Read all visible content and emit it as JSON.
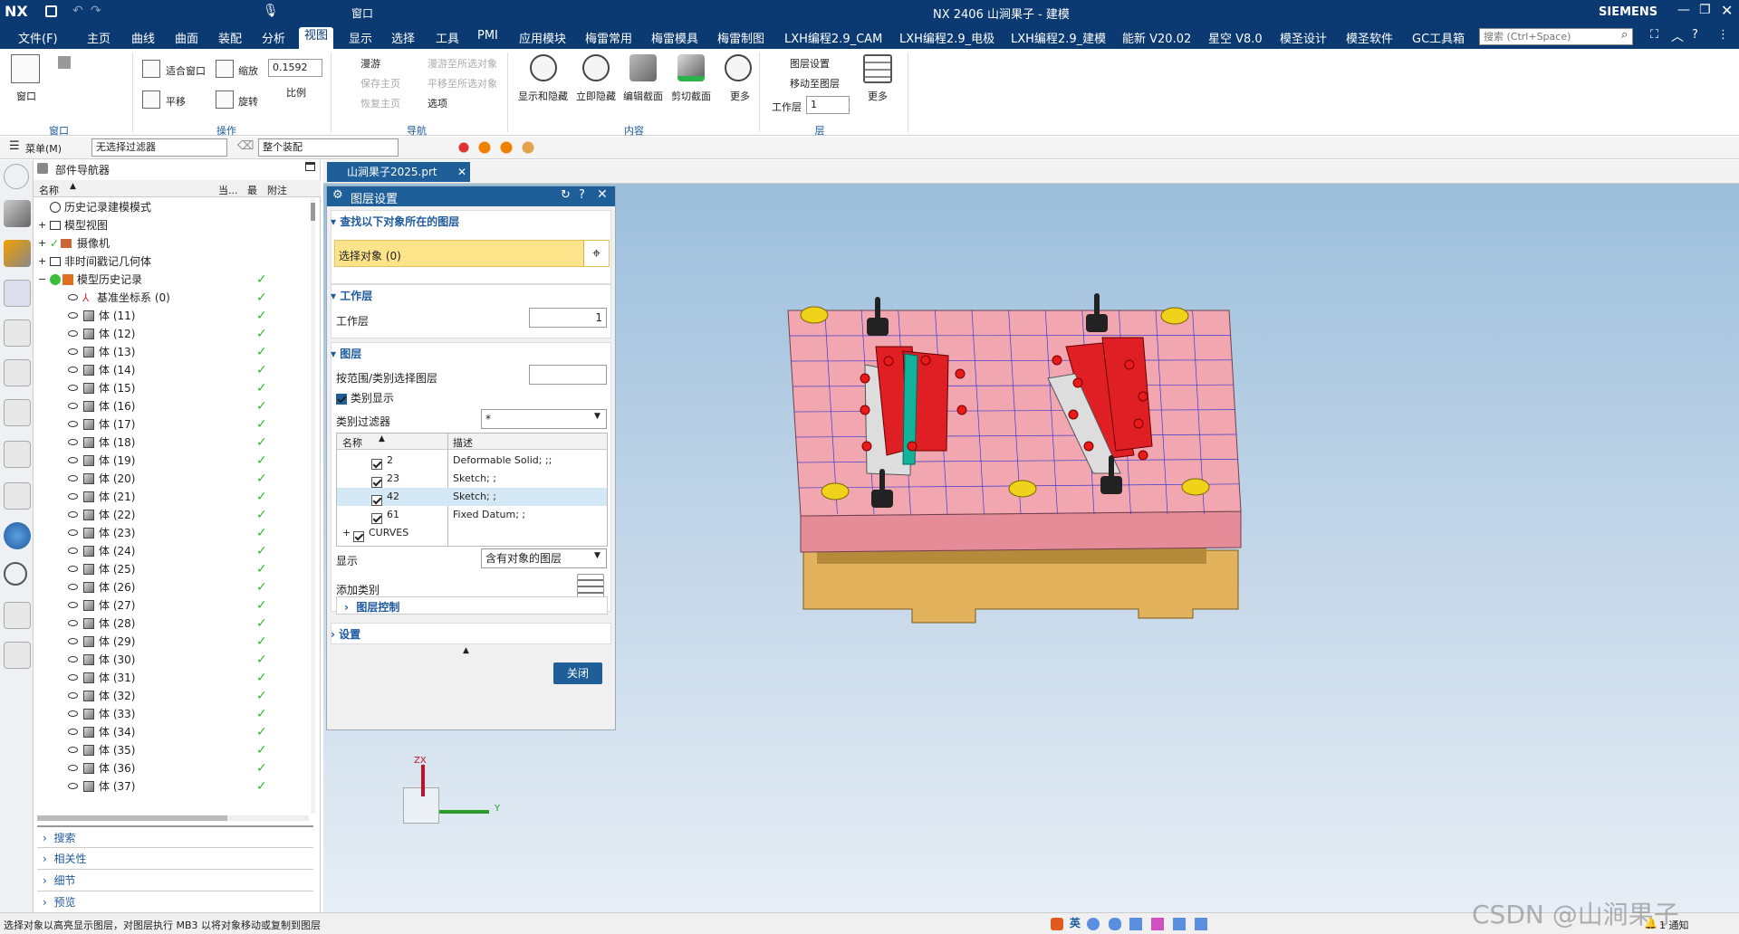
{
  "titlebar": {
    "logo": "NX",
    "title": "NX 2406 山涧果子 - 建模",
    "window_menu": "窗口",
    "brand": "SIEMENS"
  },
  "ribbon_tabs": [
    {
      "label": "文件(F)"
    },
    {
      "label": "主页"
    },
    {
      "label": "曲线"
    },
    {
      "label": "曲面"
    },
    {
      "label": "装配"
    },
    {
      "label": "分析"
    },
    {
      "label": "视图"
    },
    {
      "label": "显示"
    },
    {
      "label": "选择"
    },
    {
      "label": "工具"
    },
    {
      "label": "PMI"
    },
    {
      "label": "应用模块"
    },
    {
      "label": "梅雷常用"
    },
    {
      "label": "梅雷模具"
    },
    {
      "label": "梅雷制图"
    },
    {
      "label": "LXH编程2.9_CAM"
    },
    {
      "label": "LXH编程2.9_电极"
    },
    {
      "label": "LXH编程2.9_建模"
    },
    {
      "label": "能新 V20.02"
    },
    {
      "label": "星空 V8.0"
    },
    {
      "label": "模圣设计"
    },
    {
      "label": "模圣软件"
    },
    {
      "label": "GC工具箱"
    }
  ],
  "search": {
    "placeholder": "搜索 (Ctrl+Space)"
  },
  "ribbon": {
    "window": {
      "label": "窗口",
      "group": "窗口"
    },
    "ops": {
      "fit": "适合窗口",
      "zoom": "缩放",
      "scale_value": "0.1592",
      "scale_label": "比例",
      "pan": "平移",
      "rotate": "旋转",
      "group": "操作"
    },
    "navigation": {
      "roam": "漫游",
      "save_home": "保存主页",
      "restore_home": "恢复主页",
      "roam_to_all": "漫游至所选对象",
      "pan_to_selected": "平移至所选对象",
      "options": "选项",
      "group": "导航"
    },
    "content": {
      "show_hide": "显示和隐藏",
      "instant_hide": "立即隐藏",
      "edit_section": "编辑截面",
      "clip_section": "剪切截面",
      "more": "更多",
      "group": "内容"
    },
    "layer": {
      "settings": "图层设置",
      "move_to_layer": "移动至图层",
      "work_layer_label": "工作层",
      "work_layer_value": "1",
      "more": "更多",
      "group": "层"
    }
  },
  "qbar": {
    "menu": "菜单(M)",
    "filter": "无选择过滤器",
    "scope": "整个装配"
  },
  "navigator": {
    "title": "部件导航器",
    "columns": {
      "name": "名称",
      "current": "当...",
      "latest": "最",
      "note": "附注"
    },
    "top_rows": [
      {
        "label": "历史记录建模模式"
      },
      {
        "label": "模型视图"
      },
      {
        "label": "摄像机"
      },
      {
        "label": "非时间戳记几何体"
      },
      {
        "label": "模型历史记录"
      }
    ],
    "datum": "基准坐标系 (0)",
    "bodies": [
      "体 (11)",
      "体 (12)",
      "体 (13)",
      "体 (14)",
      "体 (15)",
      "体 (16)",
      "体 (17)",
      "体 (18)",
      "体 (19)",
      "体 (20)",
      "体 (21)",
      "体 (22)",
      "体 (23)",
      "体 (24)",
      "体 (25)",
      "体 (26)",
      "体 (27)",
      "体 (28)",
      "体 (29)",
      "体 (30)",
      "体 (31)",
      "体 (32)",
      "体 (33)",
      "体 (34)",
      "体 (35)",
      "体 (36)",
      "体 (37)"
    ],
    "panels": [
      {
        "label": "搜索"
      },
      {
        "label": "相关性"
      },
      {
        "label": "细节"
      },
      {
        "label": "预览"
      }
    ]
  },
  "doc_tab": {
    "name": "山涧果子2025.prt"
  },
  "dialog": {
    "title": "图层设置",
    "sec_find": "查找以下对象所在的图层",
    "select_obj": "选择对象 (0)",
    "sec_work": "工作层",
    "work_label": "工作层",
    "work_value": "1",
    "sec_layers": "图层",
    "range_label": "按范围/类别选择图层",
    "range_value": "",
    "category_show": "类别显示",
    "category_filter_label": "类别过滤器",
    "category_filter_value": "*",
    "table_cols": {
      "name": "名称",
      "desc": "描述"
    },
    "table_rows": [
      {
        "name": "2",
        "desc": "Deformable Solid; ;;"
      },
      {
        "name": "23",
        "desc": "Sketch; ;"
      },
      {
        "name": "42",
        "desc": "Sketch; ;"
      },
      {
        "name": "61",
        "desc": "Fixed Datum; ;"
      },
      {
        "name": "CURVES",
        "desc": ""
      }
    ],
    "display_label": "显示",
    "display_value": "含有对象的图层",
    "add_category": "添加类别",
    "layer_control": "图层控制",
    "settings": "设置",
    "close": "关闭"
  },
  "triad": {
    "zx": "ZX",
    "y": "Y"
  },
  "status": {
    "message": "选择对象以高亮显示图层，对图层执行 MB3 以将对象移动或复制到图层",
    "ime": "英",
    "notify": "1 通知",
    "watermark": "CSDN @山涧果子"
  },
  "colors": {
    "titlebar": "#0b3a73",
    "accent": "#1e5a9e",
    "plate": "#f1a6b0",
    "red_blocks": "#e01f24",
    "base_wood": "#e2b25c",
    "select_bg": "#fde38a",
    "close_btn": "#1f5f99"
  }
}
